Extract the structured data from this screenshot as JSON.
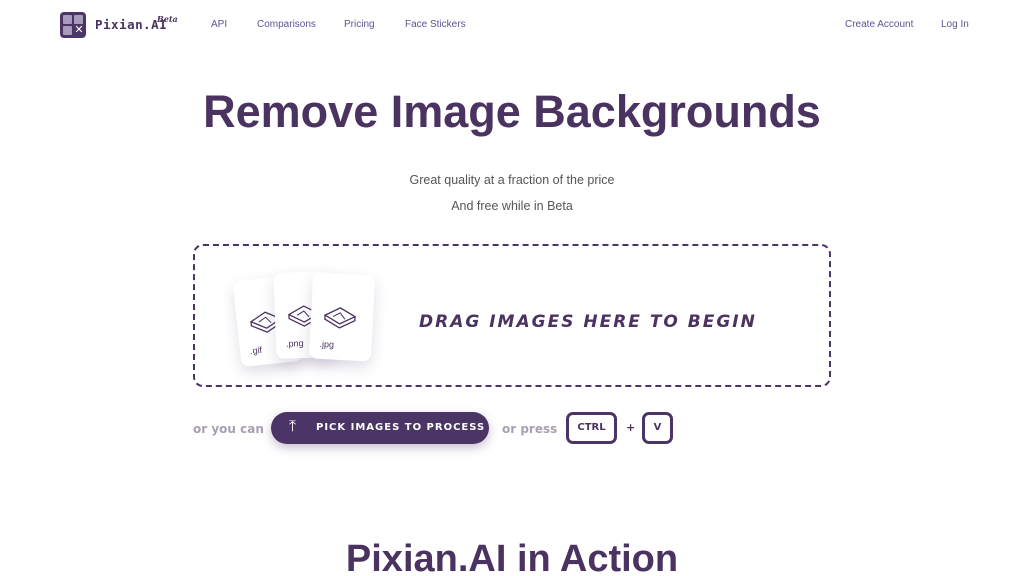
{
  "nav": {
    "brand": "Pixian.AI",
    "brand_badge": "Beta",
    "links": [
      "API",
      "Comparisons",
      "Pricing",
      "Face Stickers"
    ],
    "create_account": "Create Account",
    "login": "Log In"
  },
  "hero": {
    "title": "Remove Image Backgrounds",
    "subtitle1": "Great quality at a fraction of the price",
    "subtitle2": "And free while in Beta"
  },
  "dropzone": {
    "text": "DRAG IMAGES HERE TO BEGIN",
    "file_types": [
      ".gif",
      ".png",
      ".jpg"
    ]
  },
  "actions": {
    "or_you_can": "or you can",
    "pick_button": "PICK IMAGES TO PROCESS",
    "pick_icon": "upload-arrow-icon",
    "or_press": "or press",
    "key1": "CTRL",
    "plus": "+",
    "key2": "V"
  },
  "section": {
    "title": "Pixian.AI in Action"
  },
  "colors": {
    "brand": "#4b3566",
    "link": "#5b5596",
    "muted": "#a7a0b3"
  }
}
